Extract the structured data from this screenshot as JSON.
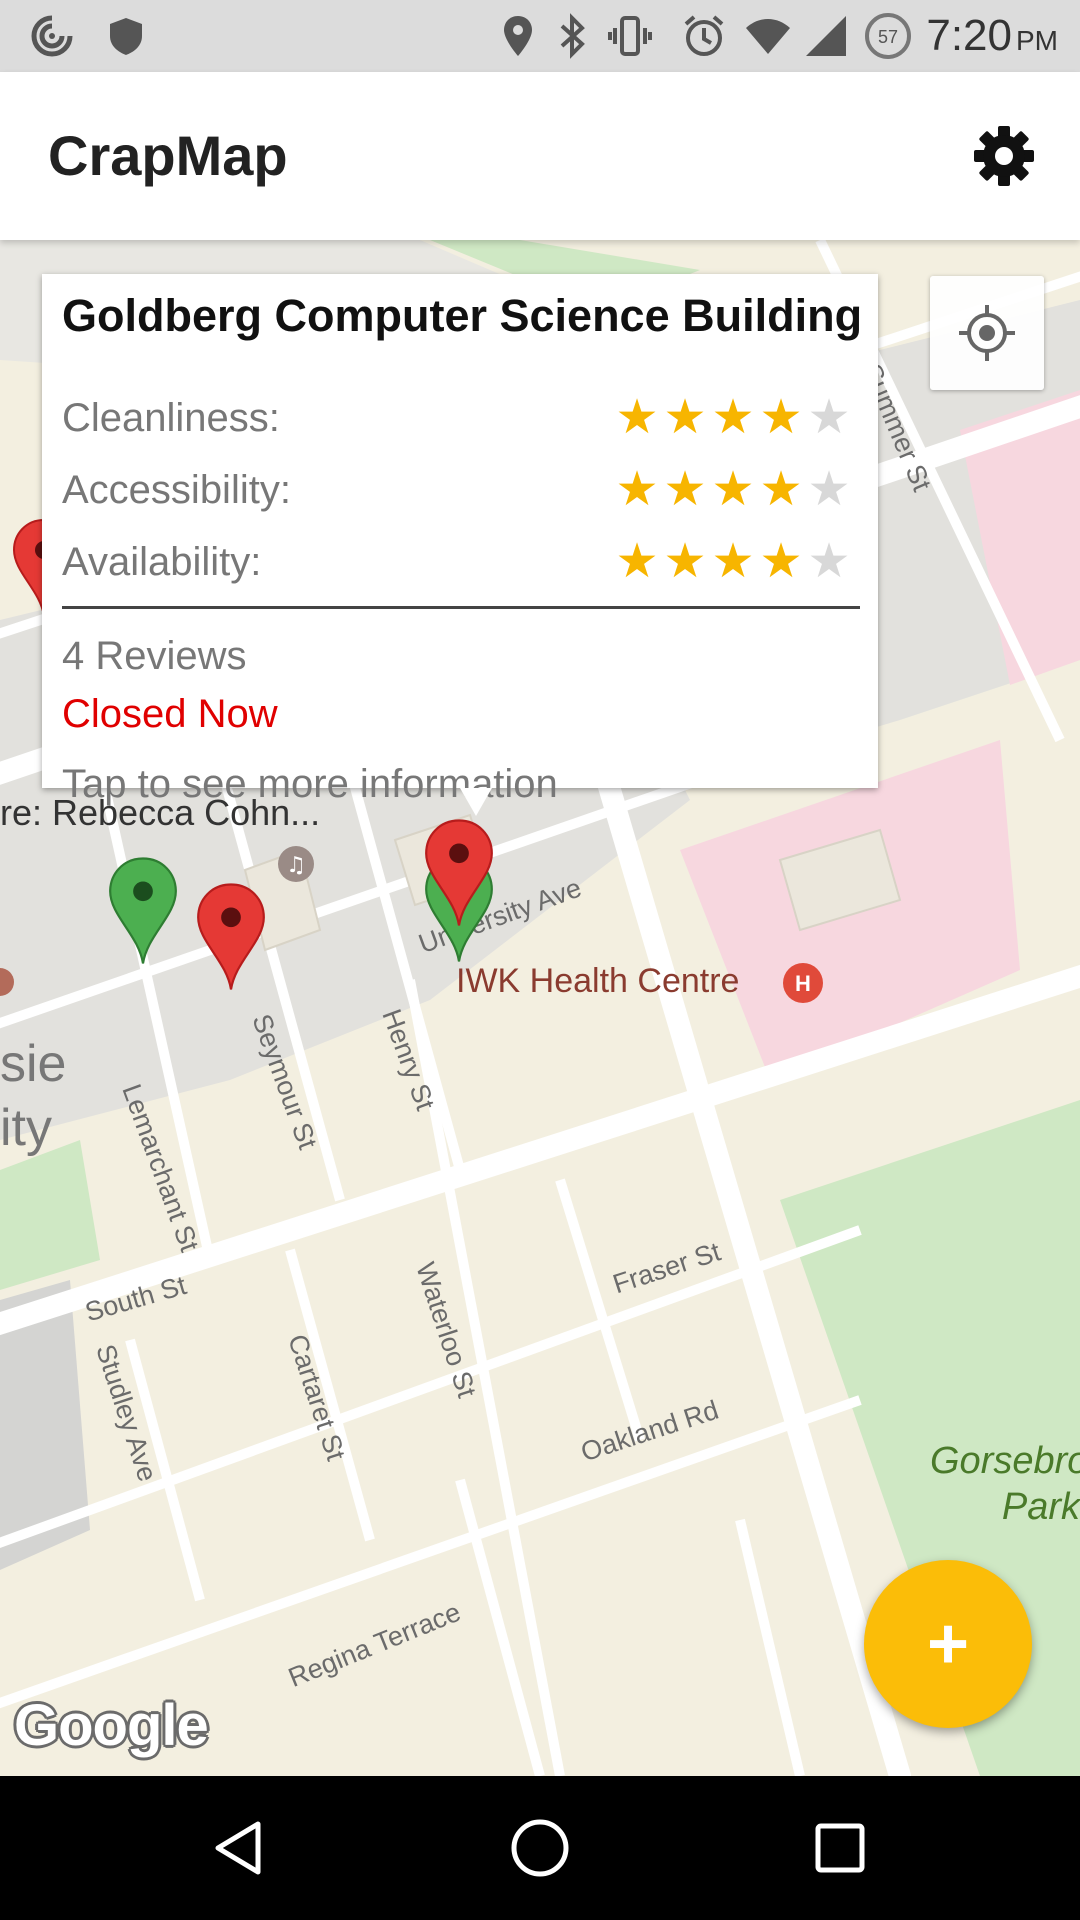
{
  "status_bar": {
    "time": "7:20",
    "ampm": "PM",
    "battery_level": "57",
    "icons": [
      "sync-icon",
      "shield-icon",
      "location-icon",
      "bluetooth-icon",
      "vibrate-icon",
      "alarm-icon",
      "wifi-icon",
      "signal-icon",
      "battery-icon"
    ]
  },
  "app_bar": {
    "title": "CrapMap",
    "settings_icon": "gear-icon"
  },
  "map": {
    "streets": [
      "Summer St",
      "University Ave",
      "Seymour St",
      "Henry St",
      "Lemarchant St",
      "South St",
      "Studley Ave",
      "Cartaret St",
      "Waterloo St",
      "Fraser St",
      "Oakland Rd",
      "Regina Terrace"
    ],
    "poi": "IWK Health Centre",
    "venue": "re: Rebecca Cohn...",
    "campus_fragment": [
      "sie",
      "ity"
    ],
    "park": [
      "Gorsebro",
      "Park"
    ],
    "attribution": "Google",
    "pins": [
      "red",
      "green",
      "red",
      "red",
      "green"
    ]
  },
  "info_window": {
    "title": "Goldberg Computer Science Building",
    "ratings": [
      {
        "label": "Cleanliness:",
        "stars": 4,
        "max": 5
      },
      {
        "label": "Accessibility:",
        "stars": 4,
        "max": 5
      },
      {
        "label": "Availability:",
        "stars": 4,
        "max": 5
      }
    ],
    "reviews": "4 Reviews",
    "status": "Closed Now",
    "hint": "Tap to see more information"
  },
  "fab": {
    "label": "+"
  },
  "nav": {
    "back": "back-icon",
    "home": "home-icon",
    "recents": "recents-icon"
  },
  "colors": {
    "accent": "#fbbd08",
    "closed": "#e00000",
    "star": "#f7b500",
    "pin_red": "#e53935",
    "pin_green": "#4caf50"
  }
}
